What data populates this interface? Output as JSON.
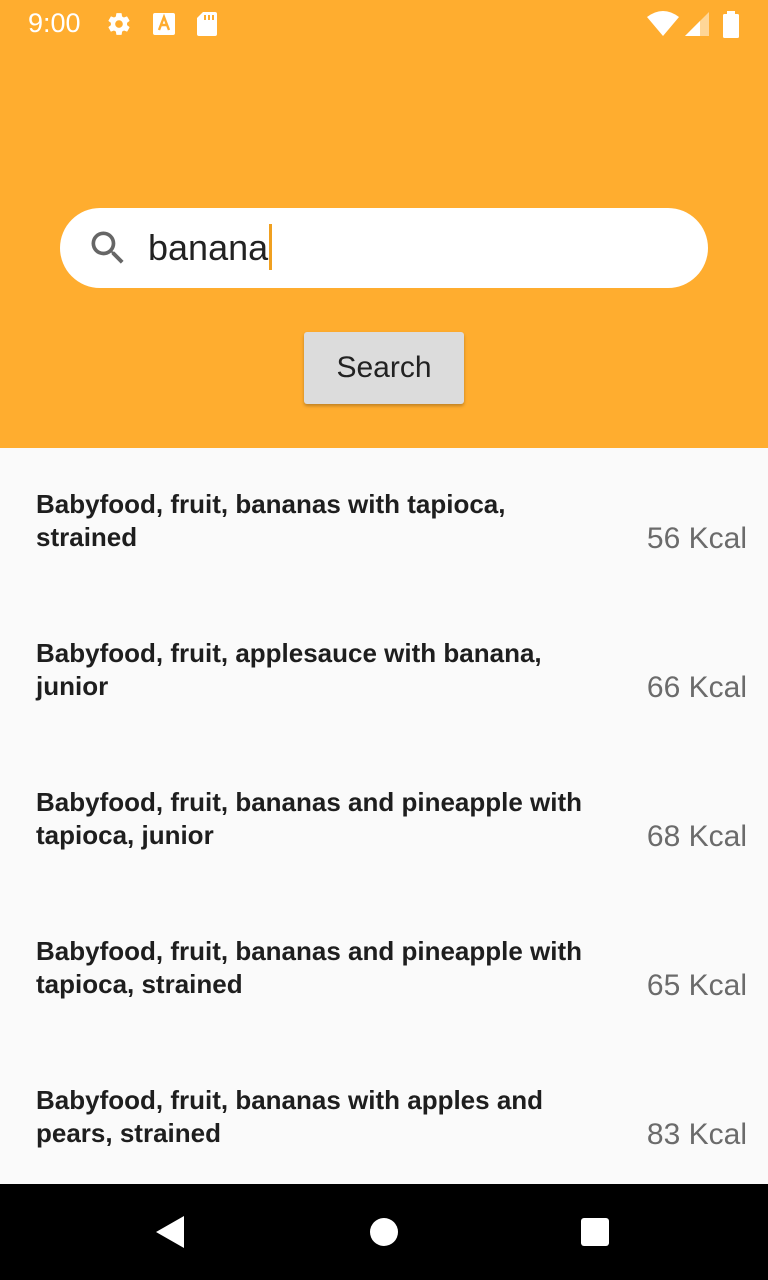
{
  "status_bar": {
    "time": "9:00",
    "icons_left": [
      "gear-icon",
      "font-a-icon",
      "sd-card-icon"
    ],
    "icons_right": [
      "wifi-icon",
      "cellular-signal-icon",
      "battery-icon"
    ]
  },
  "search": {
    "value": "banana",
    "button_label": "Search"
  },
  "results": [
    {
      "name": "Babyfood, fruit, bananas with tapioca, strained",
      "kcal": "56 Kcal"
    },
    {
      "name": "Babyfood, fruit, applesauce with banana, junior",
      "kcal": "66 Kcal"
    },
    {
      "name": "Babyfood, fruit, bananas and pineapple with tapioca, junior",
      "kcal": "68 Kcal"
    },
    {
      "name": "Babyfood, fruit, bananas and pineapple with tapioca, strained",
      "kcal": "65 Kcal"
    },
    {
      "name": "Babyfood, fruit, bananas with apples and pears, strained",
      "kcal": "83 Kcal"
    }
  ],
  "nav_bar": {
    "buttons": [
      "back-icon",
      "home-icon",
      "recents-icon"
    ]
  },
  "colors": {
    "header": "#ffad2f",
    "list_background": "#fafafa",
    "button": "#dcdcdc",
    "caret": "#f0a020"
  }
}
